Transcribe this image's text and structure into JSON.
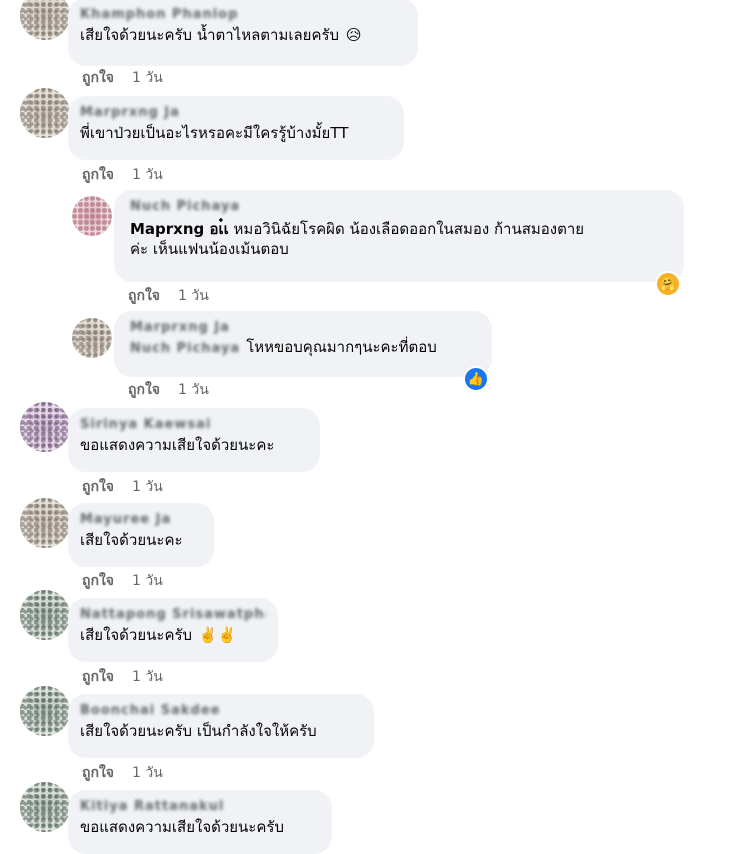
{
  "comments": [
    {
      "name": "Khamphon Phanlop",
      "text": "เสียใจด้วยนะครับ น้ำตาไหลตามเลยครับ",
      "emoji": "😥",
      "like": "ถูกใจ",
      "time": "1 วัน"
    },
    {
      "name": "Marprxng Ja",
      "text": "พี่เขาป่วยเป็นอะไรหรอคะมีใครรู้บ้างมั้ยTT",
      "like": "ถูกใจ",
      "time": "1 วัน"
    },
    {
      "name": "Nuch Pichaya",
      "tag": "Maprxng อเ๋เ",
      "text_line1": "หมอวินิฉัยโรคผิด น้องเลือดออกในสมอง ก้านสมองตาย",
      "text_line2": "ค่ะ เห็นแฟนน้องเม้นตอบ",
      "reaction": "care",
      "like": "ถูกใจ",
      "time": "1 วัน"
    },
    {
      "name": "Marprxng Ja",
      "tag": "Nuch Pichaya",
      "text": "โหหขอบคุณมากๆนะคะที่ตอบ",
      "reaction": "like",
      "like": "ถูกใจ",
      "time": "1 วัน"
    },
    {
      "name": "Sirinya Kaewsai",
      "text": "ขอแสดงความเสียใจด้วยนะคะ",
      "like": "ถูกใจ",
      "time": "1 วัน"
    },
    {
      "name": "Mayuree Ja",
      "text": "เสียใจด้วยนะคะ",
      "like": "ถูกใจ",
      "time": "1 วัน"
    },
    {
      "name": "Nattapong Srisawatphaiya",
      "text": "เสียใจด้วยนะครับ",
      "emoji": "✌️✌️",
      "like": "ถูกใจ",
      "time": "1 วัน"
    },
    {
      "name": "Boonchai Sakdee",
      "text": "เสียใจด้วยนะครับ เป็นกำลังใจให้ครับ",
      "like": "ถูกใจ",
      "time": "1 วัน"
    },
    {
      "name": "Kitiya Rattanakul",
      "text": "ขอแสดงความเสียใจด้วยนะครับ"
    }
  ]
}
